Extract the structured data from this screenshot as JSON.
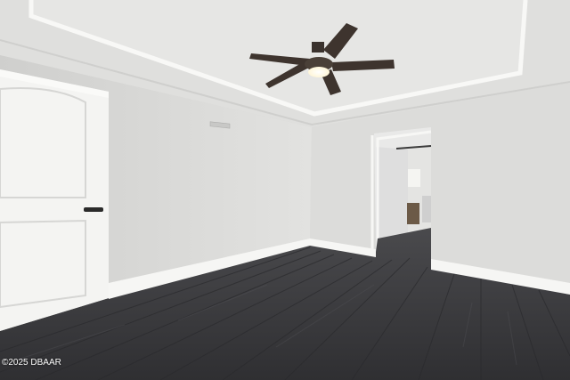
{
  "photo": {
    "watermark": "©2025 DBAAR",
    "colors": {
      "ceiling": "#e9e9e7",
      "tray_ceiling": "#dcdcda",
      "wall_left": "#d9d9d7",
      "wall_right": "#dededc",
      "trim": "#f7f7f5",
      "floor": "#3d3d40",
      "fan_blade": "#3e342e",
      "door": "#f4f4f2",
      "handle": "#2a2a2a"
    }
  }
}
